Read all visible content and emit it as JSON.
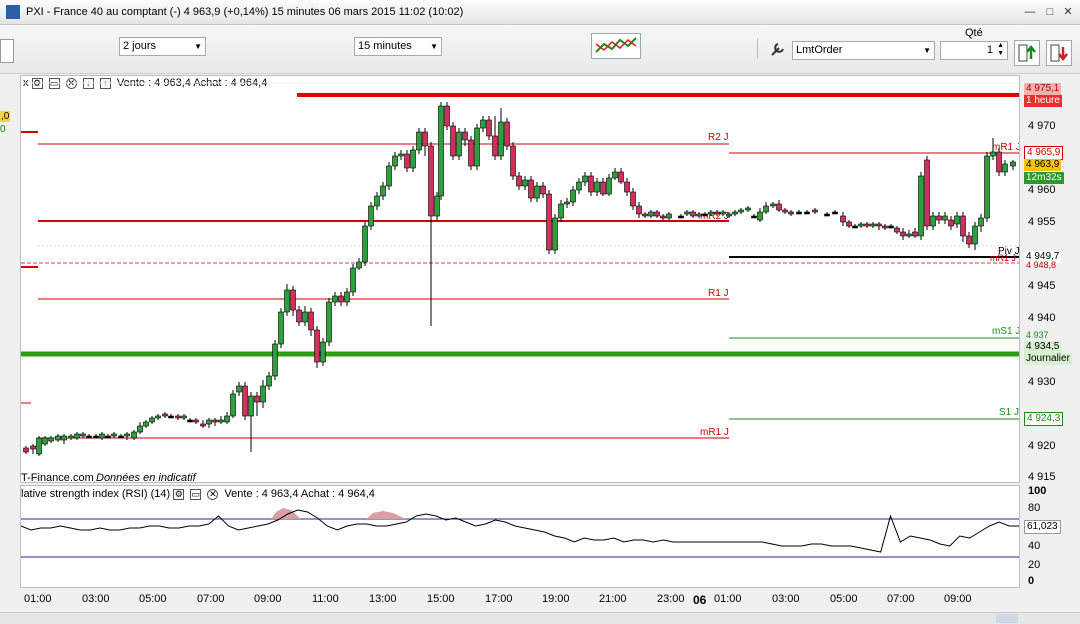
{
  "window": {
    "title": "PXI - France 40 au comptant (-)   4 963,9 (+0,14%)   15 minutes  06 mars 2015 11:02 (10:02)",
    "minimize": "—",
    "maximize": "□",
    "close": "✕"
  },
  "toolbar": {
    "period_select": "2 jours",
    "interval_select": "15 minutes",
    "order_type": "LmtOrder",
    "qty_label": "Qté",
    "qty_value": "1"
  },
  "chart": {
    "header_left": "x",
    "header_text": "Vente : 4 963,4  Achat : 4 964,4",
    "watermark": "T-Finance.com",
    "watermark_note": "Données en indicatif",
    "left_tags": [
      ",0",
      "0"
    ],
    "y_ticks": [
      "4 970",
      "4 965",
      "4 960",
      "4 955",
      "4 950",
      "4 945",
      "4 940",
      "4 935",
      "4 930",
      "4 925",
      "4 920",
      "4 915"
    ],
    "right_tags": {
      "top_price": "4 975,1",
      "top_label": "1 heure",
      "r1": "4 965,9",
      "last": "4 963,9",
      "countdown": "12m32s",
      "piv": "4 949,7",
      "piv_small": "4 948,8",
      "ms1": "4 937",
      "green_price": "4 934,5",
      "green_label": "Journalier",
      "s1": "4 924,3"
    },
    "level_labels": {
      "r2": "R2 J",
      "r1": "R1 J",
      "mr1": "mR1 J",
      "mr2": "mR2 J",
      "mr1_right": "mR1 J",
      "piv": "Piv J",
      "mr1_b": "mR1 J",
      "ms1": "mS1 J",
      "s1": "S1 J"
    }
  },
  "rsi": {
    "header_left": "lative strength index (RSI) (14)",
    "header_text": "Vente : 4 963,4  Achat : 4 964,4",
    "y_ticks": [
      "100",
      "80",
      "60",
      "40",
      "20",
      "0"
    ],
    "value_tag": "61,023"
  },
  "x_axis": {
    "labels": [
      "01:00",
      "03:00",
      "05:00",
      "07:00",
      "09:00",
      "11:00",
      "13:00",
      "15:00",
      "17:00",
      "19:00",
      "21:00",
      "23:00",
      "06",
      "01:00",
      "03:00",
      "05:00",
      "07:00",
      "09:00"
    ]
  },
  "colors": {
    "up": "#2e9e3e",
    "down": "#d0315a",
    "resistance": "#d80000",
    "support": "#1e8a1e",
    "strong_support": "#2aa012",
    "pivot": "#000000",
    "rsi_band": "#1f2a9c"
  }
}
